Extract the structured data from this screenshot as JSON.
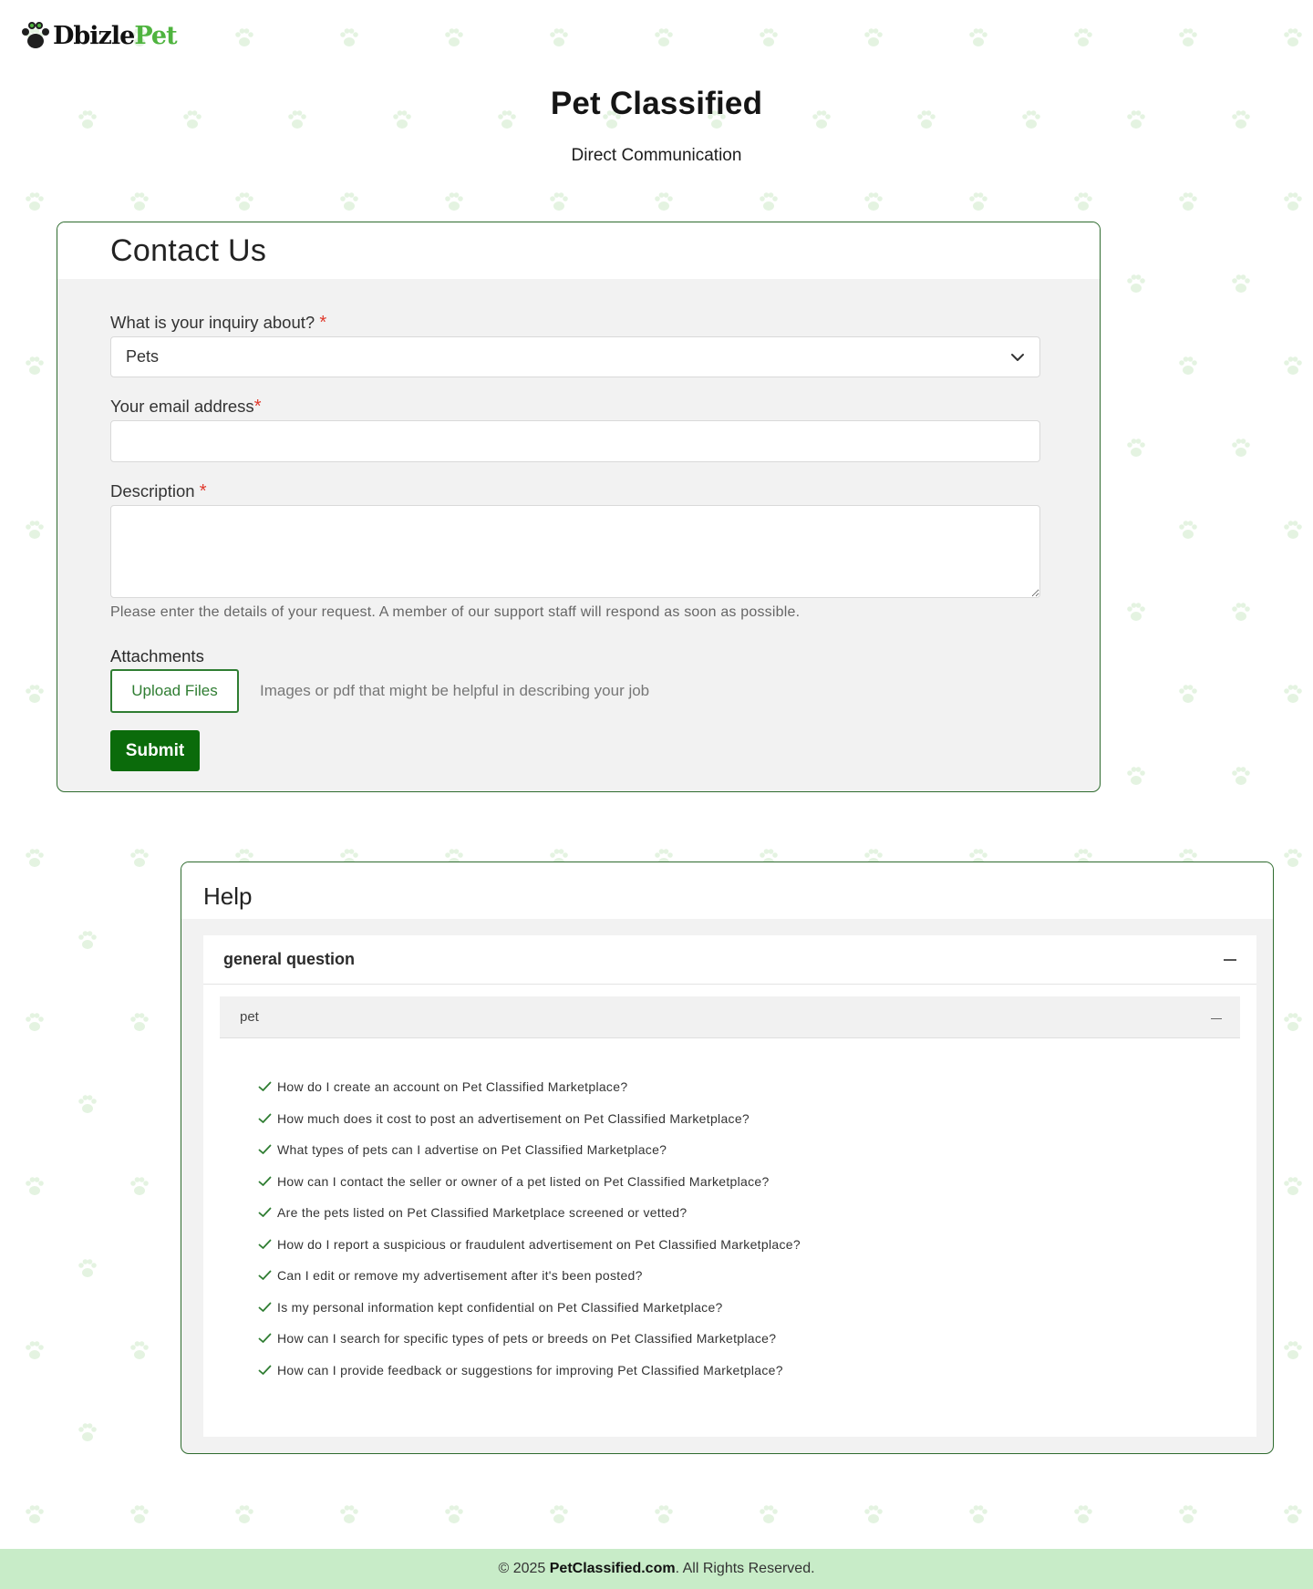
{
  "brand": {
    "logo_part1": "Dbizle",
    "logo_part2": "Pet"
  },
  "header": {
    "title": "Pet Classified",
    "subtitle": "Direct Communication"
  },
  "contact": {
    "title": "Contact Us",
    "inquiry_label": "What is your inquiry about?",
    "inquiry_value": "Pets",
    "email_label": "Your email address",
    "email_value": "",
    "description_label": "Description",
    "description_value": "",
    "description_help": "Please enter the details of your request. A member of our support staff will respond as soon as possible.",
    "attachments_label": "Attachments",
    "upload_label": "Upload Files",
    "upload_hint": "Images or pdf that might be helpful in describing your job",
    "submit_label": "Submit",
    "required_mark": "*"
  },
  "help": {
    "title": "Help",
    "section_title": "general question",
    "subsection_title": "pet",
    "questions": [
      "How do I create an account on Pet Classified Marketplace?",
      "How much does it cost to post an advertisement on Pet Classified Marketplace?",
      "What types of pets can I advertise on Pet Classified Marketplace?",
      "How can I contact the seller or owner of a pet listed on Pet Classified Marketplace?",
      "Are the pets listed on Pet Classified Marketplace screened or vetted?",
      "How do I report a suspicious or fraudulent advertisement on Pet Classified Marketplace?",
      "Can I edit or remove my advertisement after it's been posted?",
      "Is my personal information kept confidential on Pet Classified Marketplace?",
      "How can I search for specific types of pets or breeds on Pet Classified Marketplace?",
      "How can I provide feedback or suggestions for improving Pet Classified Marketplace?"
    ]
  },
  "footer": {
    "prefix": "© 2025 ",
    "site": "PetClassified.com",
    "suffix": ". All Rights Reserved."
  },
  "colors": {
    "brand_green": "#4fb43f",
    "button_green": "#0b6b0b",
    "border_green": "#2e6b2e",
    "required_red": "#e0392c",
    "footer_bg": "#c8ecc8",
    "paw": "#e4f3e1"
  }
}
